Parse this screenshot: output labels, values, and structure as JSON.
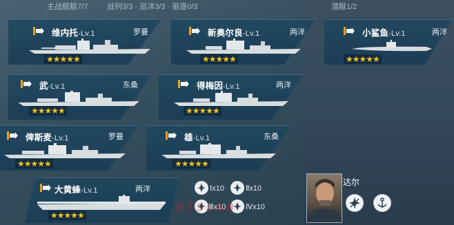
{
  "header": {
    "capital_label": "主战舰艇7/7",
    "surface_label": "战列3/3 · 巡洋3/3 · 驱逐0/3",
    "sub_label": "潜艇1/2"
  },
  "ships": [
    {
      "name": "维内托",
      "level": "-Lv.1",
      "faction": "罗曼",
      "stars": "★★★★★",
      "type": "battleship"
    },
    {
      "name": "武",
      "level": "-Lv.1",
      "faction": "东桑",
      "stars": "★★★★★",
      "type": "battleship"
    },
    {
      "name": "俾斯麦",
      "level": "-Lv.1",
      "faction": "罗曼",
      "stars": "★★★★★",
      "type": "battleship"
    },
    {
      "name": "新奥尔良",
      "level": "-Lv.1",
      "faction": "两洋",
      "stars": "★★★★★",
      "type": "cruiser"
    },
    {
      "name": "得梅因",
      "level": "-Lv.1",
      "faction": "两洋",
      "stars": "★★★★★",
      "type": "cruiser"
    },
    {
      "name": "雄",
      "level": "-Lv.1",
      "faction": "东桑",
      "stars": "★★★★★",
      "type": "cruiser"
    },
    {
      "name": "小鲨鱼",
      "level": "-Lv.1",
      "faction": "两洋",
      "stars": "★★★★★",
      "type": "submarine"
    },
    {
      "name": "大黄蜂",
      "level": "-Lv.1",
      "faction": "两洋",
      "stars": "★★★★★",
      "type": "carrier"
    }
  ],
  "aircraft": [
    {
      "label": "Ⅰx10",
      "icon": "fighter-plane-icon"
    },
    {
      "label": "Ⅱx10",
      "icon": "bomber-plane-icon"
    },
    {
      "label": "Ⅲx10",
      "icon": "torpedo-plane-icon"
    },
    {
      "label": "Ⅳx10",
      "icon": "dive-bomber-icon"
    }
  ],
  "commander": {
    "name": "达尔",
    "skills": [
      "aircraft-skill-icon",
      "anchor-skill-icon"
    ]
  },
  "watermark": "BTSLAB",
  "colors": {
    "accent": "#f0a020",
    "star": "#f3c21b",
    "card": "#1e465f"
  }
}
